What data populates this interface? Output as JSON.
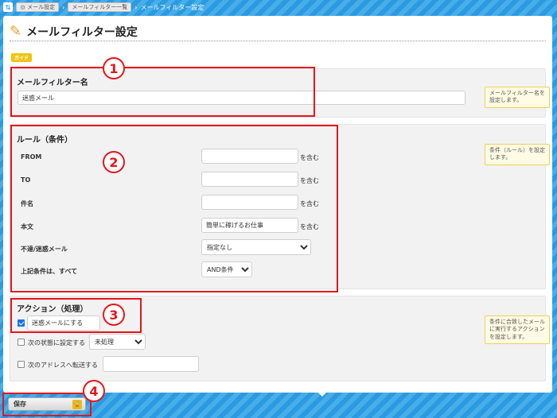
{
  "breadcrumb": {
    "items": [
      "メール設定",
      "メールフィルター一覧"
    ],
    "current": "メールフィルター設定"
  },
  "page": {
    "title": "メールフィルター設定",
    "guide_label": "ガイド"
  },
  "name_section": {
    "title": "メールフィルター名",
    "value": "迷惑メール",
    "hint": "メールフィルター名を設定します。"
  },
  "rule_section": {
    "title": "ルール（条件）",
    "hint": "条件（ルール）を設定します。",
    "rows": [
      {
        "label": "FROM",
        "value": "",
        "suffix": "を含む"
      },
      {
        "label": "TO",
        "value": "",
        "suffix": "を含む"
      },
      {
        "label": "件名",
        "value": "",
        "suffix": "を含む"
      },
      {
        "label": "本文",
        "value": "簡単に稼げるお仕事",
        "suffix": "を含む"
      }
    ],
    "spam_label": "不達/迷惑メール",
    "spam_value": "指定なし",
    "match_label": "上記条件は、すべて",
    "match_value": "AND条件"
  },
  "action_section": {
    "title": "アクション（処理）",
    "hint": "条件に合致したメールに実行するアクションを設定します。",
    "mark_spam_label": "迷惑メールにする",
    "set_status_label": "次の状態に設定する",
    "set_status_value": "未処理",
    "forward_label": "次のアドレスへ転送する",
    "forward_value": ""
  },
  "footer": {
    "save_label": "保存"
  },
  "callouts": [
    "1",
    "2",
    "3",
    "4"
  ],
  "colors": {
    "callout": "#e8141a",
    "background": "#2b9ae0",
    "hint_border": "#f3cf55",
    "guide": "#f1c40f"
  }
}
